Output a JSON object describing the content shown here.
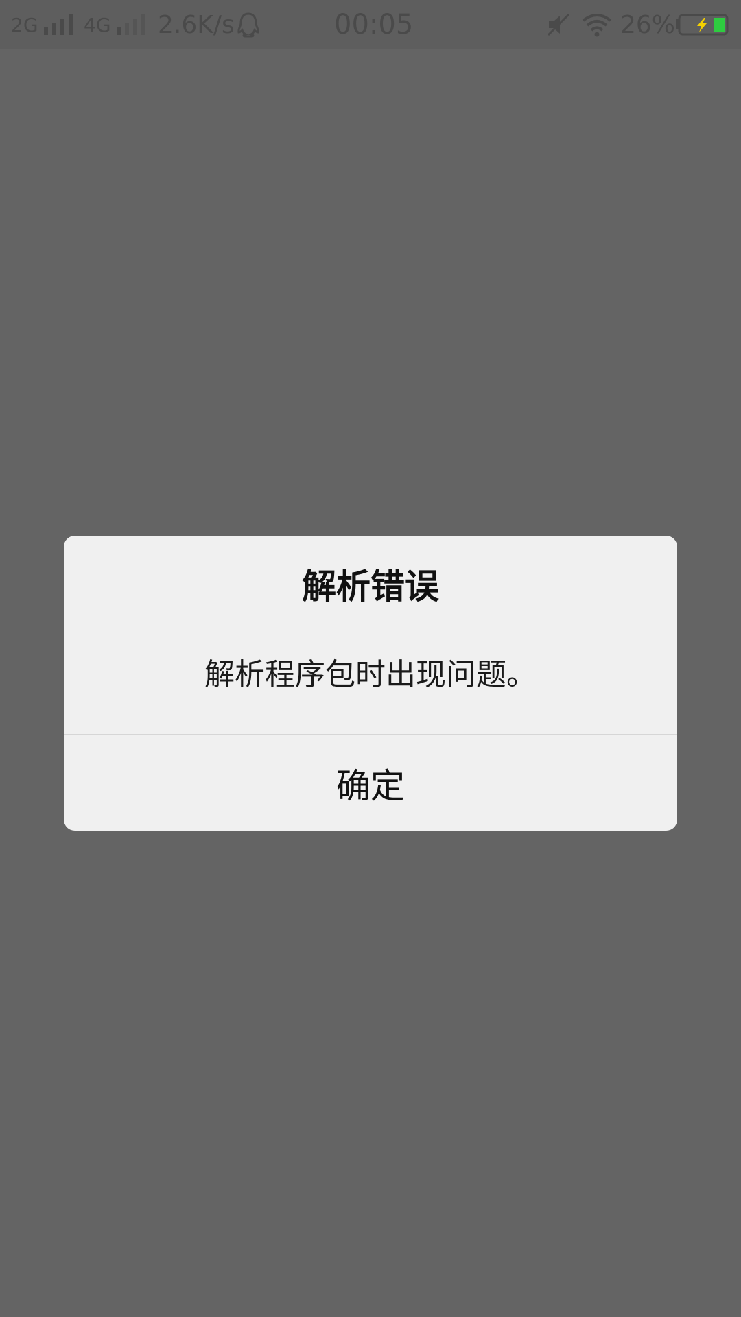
{
  "status_bar": {
    "network1": "2G",
    "network2": "4G",
    "speed": "2.6K/s",
    "time": "00:05",
    "battery_percent": "26%",
    "battery_level": 0.26,
    "icons": [
      "signal-icon",
      "qq-icon",
      "mute-icon",
      "wifi-icon",
      "battery-charging-icon"
    ]
  },
  "dialog": {
    "title": "解析错误",
    "message": "解析程序包时出现问题。",
    "confirm_label": "确定"
  },
  "colors": {
    "backdrop": "#646464",
    "dialog_bg": "#f0f0f0",
    "battery_fill": "#2ecc40",
    "charge_bolt": "#f5d000"
  }
}
